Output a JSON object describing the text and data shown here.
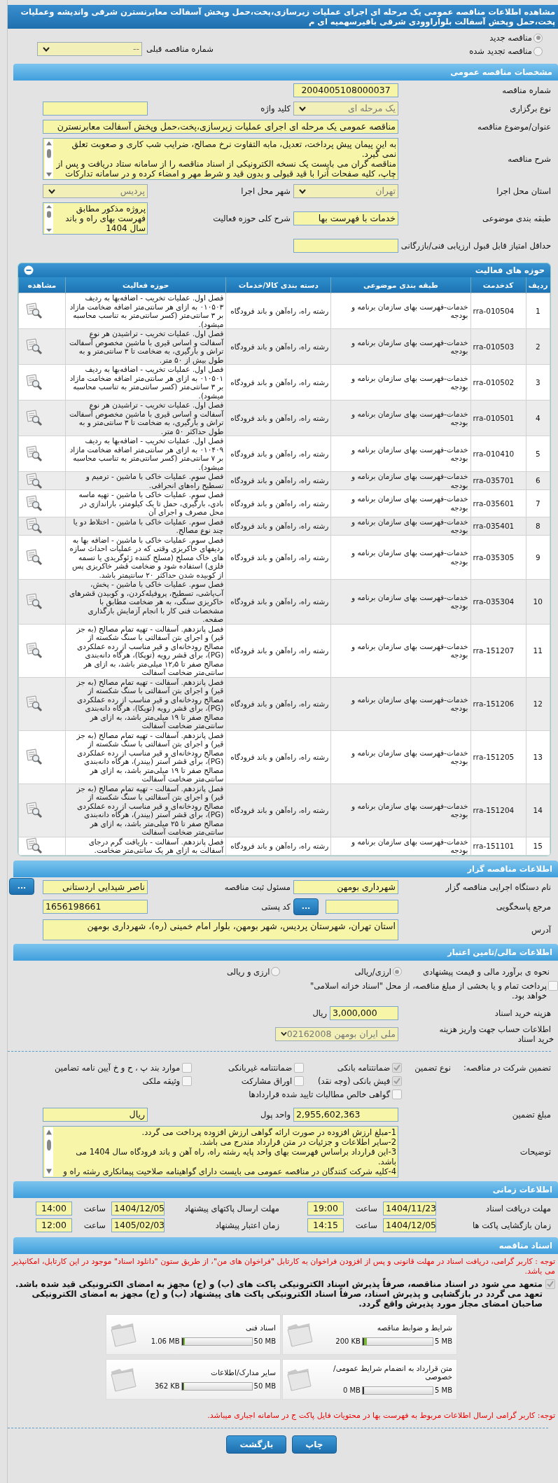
{
  "page_title": "مشاهده اطلاعات مناقصه عمومی یک مرحله ای اجرای عملیات زیرسازی،پخت،حمل وپخش آسفالت معابرنسترن شرقی واندیشه وعملیات پخت،حمل وپخش آسفالت بلواراوودی شرقی باقیرسهمیه ای م",
  "tender_kind": [
    {
      "label": "مناقصه جدید",
      "selected": true
    },
    {
      "label": "مناقصه تجدید شده",
      "selected": false
    }
  ],
  "previous_number": {
    "label": "شماره مناقصه قبلی",
    "kind": "select",
    "value": "--"
  },
  "general": {
    "title": "مشخصات مناقصه عمومی",
    "number": {
      "label": "شماره مناقصه",
      "kind": "input",
      "value": "2004005108000037"
    },
    "type": {
      "label": "نوع برگزاری",
      "kind": "select",
      "value": "یک مرحله ای"
    },
    "keyword": {
      "label": "کلید واژه",
      "kind": "input"
    },
    "subject": {
      "label": "عنوان/موضوع مناقصه",
      "kind": "input",
      "value": "مناقصه عمومی یک مرحله ای اجرای عملیات زیرسازی،پخت،حمل وپخش آسفالت معابرنسترن"
    },
    "description": {
      "label": "شرح مناقصه",
      "kind": "textarea",
      "value": "به این پیمان پیش پرداخت، تعدیل، مابه التفاوت نرخ مصالح، ضرایب شب کاری و صعوبت تعلق نمی گیرد.\nمناقصه گران می بایست یک نسخه الکترونیکی از اسناد مناقصه را از سامانه ستاد دریافت و پس از چاپ، کلیه صفحات آنرا با قید قبولی و بدون قید و شرط مهر و امضاء کرده و در سامانه تدارکات"
    },
    "province": {
      "label": "استان محل اجرا",
      "kind": "select",
      "value": "تهران"
    },
    "city": {
      "label": "شهر محل اجرا",
      "kind": "select",
      "value": "پردیس"
    },
    "category": {
      "label": "طبقه بندی موضوعی",
      "kind": "input",
      "value": "خدمات با فهرست بها"
    },
    "scope": {
      "label": "شرح کلی حوزه فعالیت",
      "kind": "textarea",
      "value": "پروژه مذکور مطابق فهرست بهای راه و باند سال 1404"
    },
    "min_score": {
      "label": "حداقل امتیاز قابل قبول ارزیابی فنی/بازرگانی",
      "kind": "input"
    }
  },
  "activities": {
    "title": "حوزه های فعالیت",
    "columns": [
      "ردیف",
      "کدخدمت",
      "طبقه بندی موضوعی",
      "دسته بندی کالا/خدمات",
      "حوزه فعالیت",
      "مشاهده"
    ],
    "rows": [
      {
        "index": "1",
        "code": "rra-010504",
        "category": "خدمات-فهرست بهای سازمان برنامه و بودجه",
        "group": "رشته راه، راه‌آهن و باند فرودگاه",
        "activity": "فصل اول. عملیات تخریب - اضافه‌بها به ردیف ۰۱۰۵۰۳ به ازای هر سانتی‌متر اضافه ضخامت مازاد بر ۳ سانتی‌متر (کسر سانتی‌متر به تناسب محاسبه میشود)."
      },
      {
        "index": "2",
        "code": "rra-010503",
        "category": "خدمات-فهرست بهای سازمان برنامه و بودجه",
        "group": "رشته راه، راه‌آهن و باند فرودگاه",
        "activity": "فصل اول. عملیات تخریب - تراشیدن هر نوع آسفالت و اساس قیری با ماشین مخصوص آسفالت تراش و بارگیری، به ضخامت تا ۳ سانتی‌متر و به طول بیش از ۵۰ متر."
      },
      {
        "index": "3",
        "code": "rra-010502",
        "category": "خدمات-فهرست بهای سازمان برنامه و بودجه",
        "group": "رشته راه، راه‌آهن و باند فرودگاه",
        "activity": "فصل اول. عملیات تخریب - اضافه‌بها به ردیف ۰۱۰۵۰۱ به ازای هر سانتی‌متر اضافه ضخامت مازاد بر ۳ سانتی‌متر (کسر سانتی‌متر به تناسب محاسبه میشود)."
      },
      {
        "index": "4",
        "code": "rra-010501",
        "category": "خدمات-فهرست بهای سازمان برنامه و بودجه",
        "group": "رشته راه، راه‌آهن و باند فرودگاه",
        "activity": "فصل اول. عملیات تخریب - تراشیدن هر نوع آسفالت و اساس قیری با ماشین مخصوص آسفالت تراش و بارگیری، به ضخامت تا ۳ سانتی‌متر و به طول حداکثر ۵۰ متر."
      },
      {
        "index": "5",
        "code": "rra-010410",
        "category": "خدمات-فهرست بهای سازمان برنامه و بودجه",
        "group": "رشته راه، راه‌آهن و باند فرودگاه",
        "activity": "فصل اول. عملیات تخریب - اضافه‌بها به ردیف ۰۱۰۴۰۹ به ازای هر سانتی‌متر اضافه ضخامت مازاد بر ۷ سانتی‌متر (کسر سانتی‌متر به تناسب محاسبه میشود)."
      },
      {
        "index": "6",
        "code": "rra-035701",
        "category": "خدمات-فهرست بهای سازمان برنامه و بودجه",
        "group": "رشته راه، راه‌آهن و باند فرودگاه",
        "activity": "فصل سوم. عملیات خاکی با ماشین - ترمیم و تسطیح راه‌های انحرافی."
      },
      {
        "index": "7",
        "code": "rra-035601",
        "category": "خدمات-فهرست بهای سازمان برنامه و بودجه",
        "group": "رشته راه، راه‌آهن و باند فرودگاه",
        "activity": "فصل سوم. عملیات خاکی با ماشین - تهیه ماسه بادی، بارگیری، حمل تا یک کیلومتر، باراندازی در محل مصرف و اجرای آن"
      },
      {
        "index": "8",
        "code": "rra-035401",
        "category": "خدمات-فهرست بهای سازمان برنامه و بودجه",
        "group": "رشته راه، راه‌آهن و باند فرودگاه",
        "activity": "فصل سوم. عملیات خاکی با ماشین - اختلاط دو یا چند نوع مصالح."
      },
      {
        "index": "9",
        "code": "rra-035305",
        "category": "خدمات-فهرست بهای سازمان برنامه و بودجه",
        "group": "رشته راه، راه‌آهن و باند فرودگاه",
        "activity": "فصل سوم. عملیات خاکی با ماشین - اضافه بها به ردیفهای خاکریزی وقتی که در عملیات احداث سازه های خاک مسلح (مسلح کننده ژئوگریدی یا تسمه فلزی) استفاده شود و ضخامت قشر خاکریزی پس از کوبیده شدن حداکثر ۲۰ سانتیمتر باشد."
      },
      {
        "index": "10",
        "code": "rra-035304",
        "category": "خدمات-فهرست بهای سازمان برنامه و بودجه",
        "group": "رشته راه، راه‌آهن و باند فرودگاه",
        "activity": "فصل سوم. عملیات خاکی با ماشین - پخش، آب‌پاشی، تسطیح، پروفیله‌کردن، و کوبیدن قشرهای خاکریزی سنگی، به هر ضخامت مطابق با مشخصات فنی کار با انجام آزمایش بارگذاری صفحه."
      },
      {
        "index": "11",
        "code": "rra-151207",
        "category": "خدمات-فهرست بهای سازمان برنامه و بودجه",
        "group": "رشته راه، راه‌آهن و باند فرودگاه",
        "activity": "فصل پانزدهم. آسفالت - تهیه تمام مصالح (به جز قیر) و اجرای بتن آسفالتی با سنگ شکسته از مصالح رودخانه‌ای و قیر مناسب از رده عملکردی (PG)، برای قشر رویه (توپکا)، هرگاه دانه‌بندی مصالح صفر تا ۱۲٫۵ میلی‌متر باشد، به ازای هر سانتی‌متر ضخامت آسفالت"
      },
      {
        "index": "12",
        "code": "rra-151206",
        "category": "خدمات-فهرست بهای سازمان برنامه و بودجه",
        "group": "رشته راه، راه‌آهن و باند فرودگاه",
        "activity": "فصل پانزدهم. آسفالت - تهیه تمام مصالح (به جز قیر) و اجرای بتن آسفالتی با سنگ شکسته از مصالح رودخانه‌ای و قیر مناسب از رده عملکردی (PG)، برای قشر رویه (توپکا)، هرگاه دانه‌بندی مصالح صفر تا ۱۹ میلی‌متر باشد، به ازای هر سانتی‌متر ضخامت آسفالت"
      },
      {
        "index": "13",
        "code": "rra-151205",
        "category": "خدمات-فهرست بهای سازمان برنامه و بودجه",
        "group": "رشته راه، راه‌آهن و باند فرودگاه",
        "activity": "فصل پانزدهم. آسفالت - تهیه تمام مصالح (به جز قیر) و اجرای بتن آسفالتی با سنگ شکسته از مصالح رودخانه‌ای و قیر مناسب از رده عملکردی (PG)، برای قشر آستر (بیندر)، هرگاه دانه‌بندی مصالح صفر تا ۱۹ میلی‌متر باشد، به ازای هر سانتی‌متر ضخامت آسفالت"
      },
      {
        "index": "14",
        "code": "rra-151204",
        "category": "خدمات-فهرست بهای سازمان برنامه و بودجه",
        "group": "رشته راه، راه‌آهن و باند فرودگاه",
        "activity": "فصل پانزدهم. آسفالت - تهیه تمام مصالح (به جز قیر) و اجرای بتن آسفالتی با سنگ شکسته از مصالح رودخانه‌ای و قیر مناسب از رده عملکردی (PG)، برای قشر آستر (بیندر)، هرگاه دانه‌بندی مصالح صفر تا ۲۵ میلی‌متر باشد، به ازای هر سانتی‌متر ضخامت آسفالت"
      },
      {
        "index": "15",
        "code": "rra-151101",
        "category": "خدمات-فهرست بهای سازمان برنامه و بودجه",
        "group": "رشته راه، راه‌آهن و باند فرودگاه",
        "activity": "فصل پانزدهم. آسفالت - بازیافت گرم درجای آسفالت به ازای هر یک سانتی‌متر ضخامت."
      }
    ]
  },
  "organizer": {
    "title": "اطلاعات مناقصه گزار",
    "agency": {
      "label": "نام دستگاه اجرایی مناقصه گزار",
      "kind": "input",
      "value": "شهرداری بومهن"
    },
    "registrar": {
      "label": "مسئول ثبت مناقصه",
      "kind": "input",
      "value": "ناصر شیدایی اردستانی"
    },
    "registrar_button": "...",
    "reference": {
      "label": "مرجع پاسخگویی",
      "kind": "input"
    },
    "reference_button": "...",
    "postal_code": {
      "label": "کد پستی",
      "kind": "input",
      "value": "1656198661"
    },
    "address": {
      "label": "آدرس",
      "kind": "input",
      "value": "استان تهران، شهرستان پردیس، شهر بومهن، بلوار امام خمینی (ره)، شهرداری بومهن"
    }
  },
  "finance": {
    "title": "اطلاعات مالی/تامین اعتبار",
    "estimate_label": "نحوه ی برآورد مالی و قیمت پیشنهادی",
    "estimate_options": [
      {
        "label": "ارزی/ریالی",
        "selected": true
      },
      {
        "label": "ارزی و ریالی",
        "selected": false
      }
    ],
    "treasury": {
      "label": "پرداخت تمام و یا بخشی از مبلغ مناقصه، از محل \"اسناد خزانه اسلامی\" خواهد بود.",
      "checked": false
    },
    "doc_fee": {
      "label": "هزینه خرید اسناد",
      "kind": "input",
      "value": "3,000,000",
      "unit": "ریال"
    },
    "account": {
      "label": "اطلاعات حساب جهت واریز هزینه خرید اسناد",
      "kind": "select",
      "value": "ملی ایران بومهن 02162008"
    },
    "guarantee_label": "تضمین شرکت در مناقصه:",
    "guarantee_type_label": "نوع تضمین",
    "guarantees": [
      {
        "label": "ضمانتنامه بانکی",
        "checked": true
      },
      {
        "label": "ضمانتنامه غیربانکی",
        "checked": false
      },
      {
        "label": "موارد بند پ ، ح و خ آیین نامه تضامین",
        "checked": false
      },
      {
        "label": "فیش بانکی (وجه نقد)",
        "checked": true
      },
      {
        "label": "اوراق مشارکت",
        "checked": false
      },
      {
        "label": "وثیقه ملکی",
        "checked": false
      },
      {
        "label": "گواهی خالص مطالبات تایید شده قراردادها",
        "checked": false
      }
    ],
    "amount": {
      "label": "مبلغ تضمین",
      "kind": "input",
      "value": "2,955,602,363"
    },
    "currency": {
      "label": "واحد پول",
      "kind": "input",
      "value": "ریال"
    },
    "notes": {
      "label": "توضیحات",
      "kind": "textarea",
      "value": "1-مبلغ ارزش افزوده در صورت ارائه گواهی ارزش افزوده پرداخت می گردد.\n2-سایر اطلاعات و جزئیات در متن قرارداد مندرج می باشد.\n3-این قرارداد براساس فهرست بهای واحد پایه رشته راه، راه آهن و باند فرودگاه سال 1404 می باشد.\n4-کلیه شرکت کنندگان در مناقصه عمومی می بایست دارای گواهینامه صلاحیت پیمانکاری رشته راه و"
    }
  },
  "timing": {
    "title": "اطلاعات زمانی",
    "items": [
      {
        "label": "مهلت دریافت اسناد",
        "date": "1404/11/23",
        "time_label": "ساعت",
        "time": "19:00"
      },
      {
        "label": "مهلت ارسال پاکتهای پیشنهاد",
        "date": "1404/12/05",
        "time_label": "ساعت",
        "time": "14:00"
      },
      {
        "label": "زمان بازگشایی پاکت ها",
        "date": "1404/12/05",
        "time_label": "ساعت",
        "time": "14:15"
      },
      {
        "label": "زمان اعتبار پیشنهاد",
        "date": "1405/02/03",
        "time_label": "ساعت",
        "time": "12:00"
      }
    ]
  },
  "documents": {
    "title": "اسناد مناقصه",
    "notice": "توجه : کاربر گرامی، دریافت اسناد در مهلت قانونی و پس از افزودن فراخوان به کارتابل \"فراخوان های من\"، از طریق ستون \"دانلود اسناد\" موجود در این کارتابل، امکانپذیر می باشد.",
    "commitment": {
      "label": "متعهد می شود در اسناد مناقصه، صرفاً پذیرش اسناد الکترونیکی پاکت های (ب) و (ج) مجهز به امضای الکترونیکی قید شده باشد. تعهد می گردد در بازگشایی و پذیرش اسناد، صرفاً اسناد الکترونیکی پاکت های پیشنهاد (ب) و (ج) مجهز به امضای الکترونیکی صاحبان امضای مجاز مورد پذیرش واقع گردد.",
      "checked": true
    },
    "files": [
      {
        "name": "شرایط و ضوابط مناقصه",
        "size": "200 KB",
        "max": "5 MB",
        "level": 0.04
      },
      {
        "name": "اسناد فنی",
        "size": "1.06 MB",
        "max": "50 MB",
        "level": 0.02
      },
      {
        "name": "متن قرارداد به انضمام شرایط عمومی/خصوصی",
        "size": "0 MB",
        "max": "5 MB",
        "level": 0
      },
      {
        "name": "سایر مدارک/اطلاعات",
        "size": "362 KB",
        "max": "50 MB",
        "level": 0.01
      }
    ],
    "footnote": "توجه: کاربر گرامی ارسال اطلاعات مربوط به فهرست بها در محتویات فایل پاکت ج در سامانه اجباری میباشد."
  },
  "buttons": [
    "چاپ",
    "بازگشت"
  ]
}
